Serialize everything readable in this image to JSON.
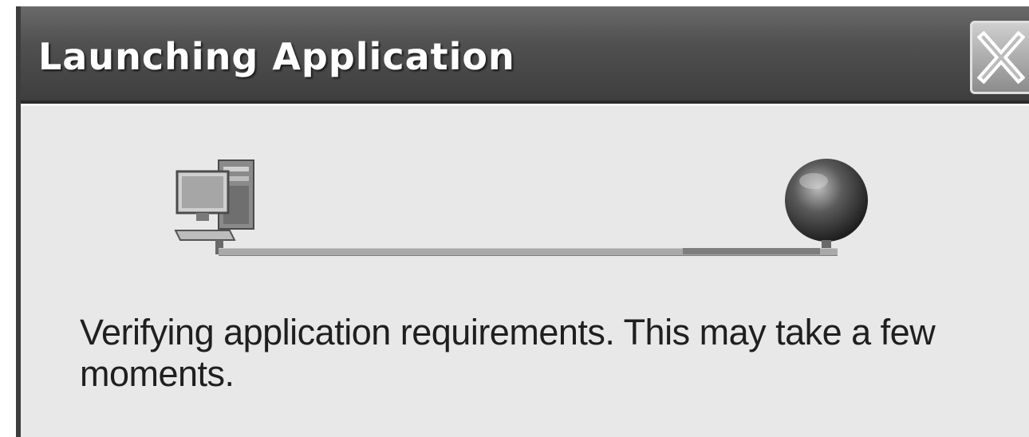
{
  "dialog": {
    "title": "Launching Application",
    "close_icon": "close-icon",
    "status_message": "Verifying application requirements. This may take a few moments."
  },
  "icons": {
    "source": "computer-icon",
    "destination": "globe-icon"
  },
  "colors": {
    "titlebar": "#4f4f4f",
    "content_background": "#e8e8e8",
    "title_text": "#ffffff",
    "line": "#a9a9a9"
  }
}
